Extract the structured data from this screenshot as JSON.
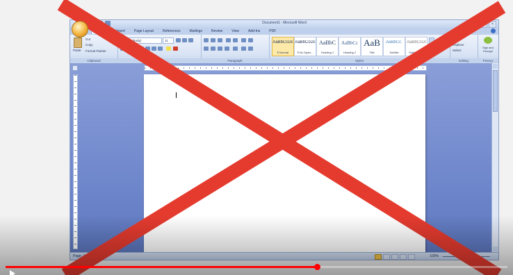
{
  "window": {
    "title": "Document1 - Microsoft Word"
  },
  "tabs": [
    "Home",
    "Insert",
    "Page Layout",
    "References",
    "Mailings",
    "Review",
    "View",
    "Add-Ins",
    "PDF"
  ],
  "ribbon": {
    "clipboard": {
      "paste": "Paste",
      "cut": "Cut",
      "copy": "Copy",
      "format_painter": "Format Painter",
      "label": "Clipboard"
    },
    "font": {
      "name": "Calibri (Body)",
      "size": "11",
      "label": "Font"
    },
    "paragraph": {
      "label": "Paragraph"
    },
    "styles": {
      "label": "Styles",
      "items": [
        {
          "sample": "AaBbCcDc",
          "name": "¶ Normal",
          "selected": true
        },
        {
          "sample": "AaBbCcDc",
          "name": "¶ No Spaci...",
          "selected": false
        },
        {
          "sample": "AaBbC",
          "name": "Heading 1",
          "selected": false
        },
        {
          "sample": "AaBbCc",
          "name": "Heading 2",
          "selected": false
        },
        {
          "sample": "AaB",
          "name": "Title",
          "selected": false
        },
        {
          "sample": "AaBbCc.",
          "name": "Subtitle",
          "selected": false
        },
        {
          "sample": "AaBbCcDi",
          "name": "Subtle Em...",
          "selected": false
        }
      ]
    },
    "editing": {
      "find": "Find",
      "replace": "Replace",
      "select": "Select",
      "label": "Editing"
    },
    "privacy": {
      "sign": "Sign and Encrypt",
      "label": "Privacy"
    }
  },
  "status": {
    "page": "Page: 1 of 1",
    "zoom": "100%"
  },
  "video": {
    "progress": 0.62
  },
  "colors": {
    "x_red": "#e53b2f",
    "progress_red": "#ff0000"
  }
}
